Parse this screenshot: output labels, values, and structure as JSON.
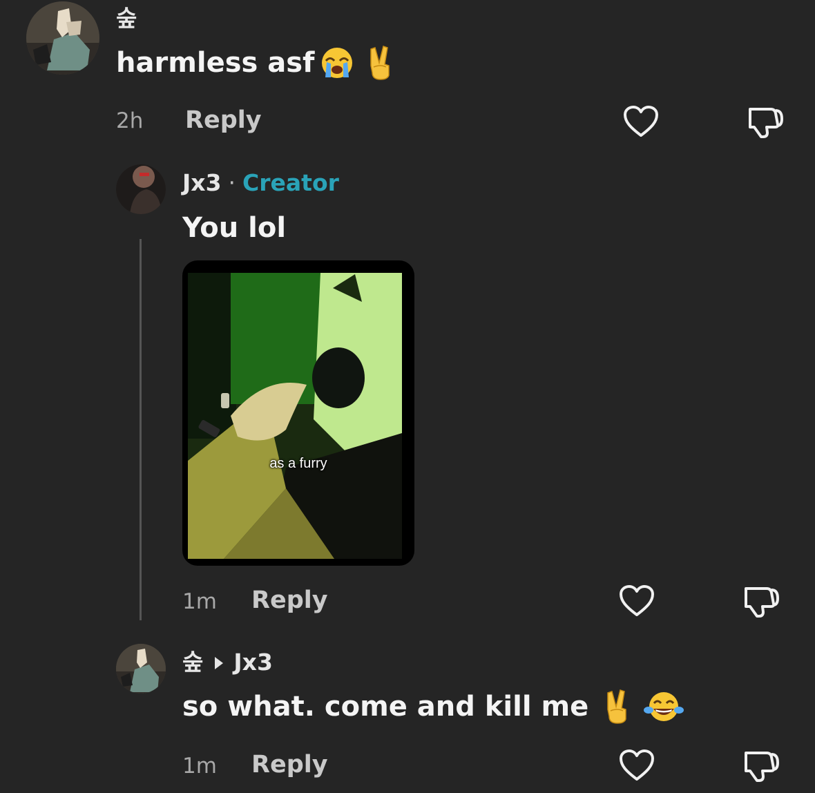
{
  "comments": [
    {
      "username": "숲",
      "text": "harmless asf",
      "emojis": [
        "loudly-crying-face-emoji",
        "victory-hand-emoji"
      ],
      "time": "2h",
      "reply_label": "Reply"
    },
    {
      "username": "Jx3",
      "separator": "·",
      "badge": "Creator",
      "text": "You lol",
      "media_caption": "as a furry",
      "time": "1m",
      "reply_label": "Reply"
    },
    {
      "username": "숲",
      "reply_to": "Jx3",
      "text": "so what. come and kill me",
      "emojis": [
        "victory-hand-emoji",
        "face-with-tears-of-joy-emoji"
      ],
      "time": "1m",
      "reply_label": "Reply"
    }
  ],
  "colors": {
    "background": "#252525",
    "creator_badge": "#2aa3b8",
    "text": "#f4f4f4",
    "meta": "#a8a8a8"
  },
  "icons": [
    "heart-icon",
    "dislike-icon",
    "reply-arrow-icon"
  ]
}
